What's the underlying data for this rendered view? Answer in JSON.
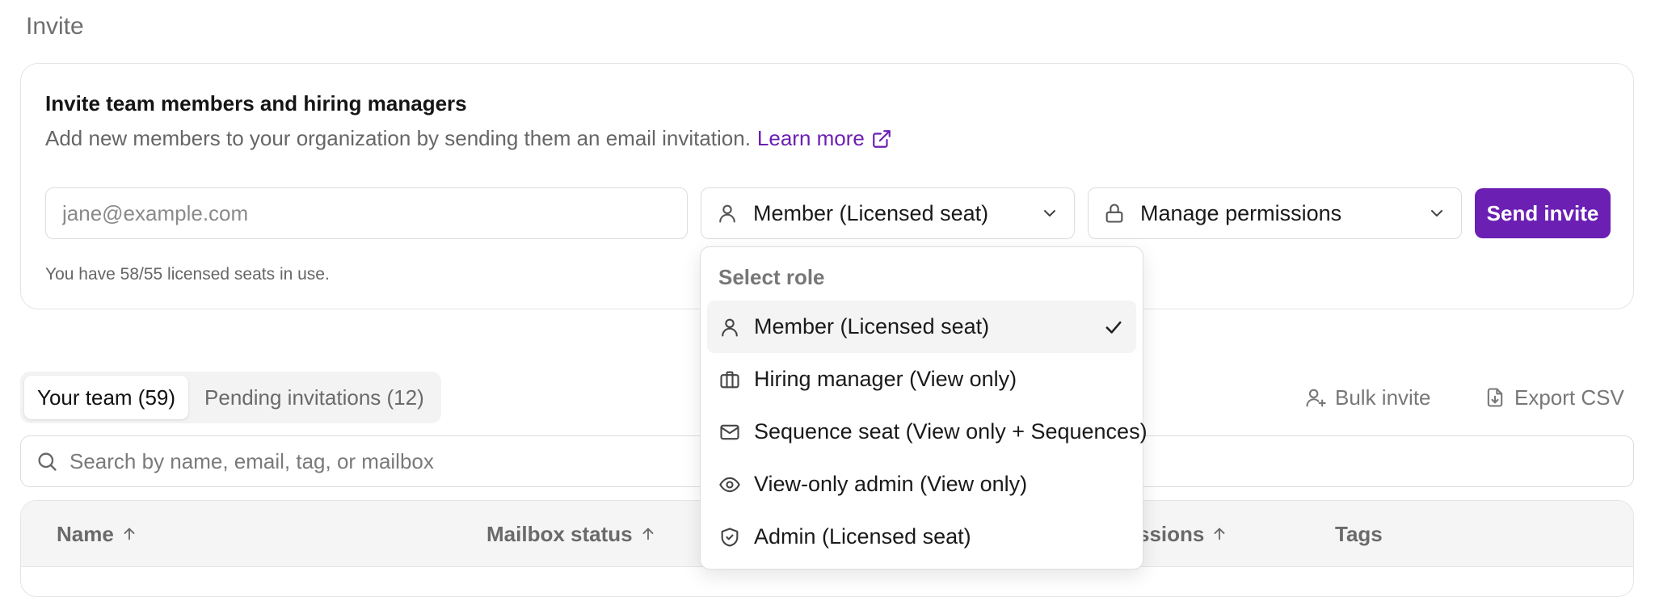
{
  "page": {
    "title": "Invite"
  },
  "invite_card": {
    "heading": "Invite team members and hiring managers",
    "description": "Add new members to your organization by sending them an email invitation.",
    "learn_more": "Learn more",
    "email_placeholder": "jane@example.com",
    "email_value": "",
    "role_select": {
      "selected": "Member (Licensed seat)",
      "icon": "user-icon"
    },
    "permissions_select": {
      "selected": "Manage permissions",
      "icon": "lock-icon"
    },
    "send_button": "Send invite",
    "seats_note": "You have 58/55 licensed seats in use."
  },
  "tabs": [
    {
      "label": "Your team (59)",
      "active": true
    },
    {
      "label": "Pending invitations (12)",
      "active": false
    }
  ],
  "actions": {
    "bulk_invite": "Bulk invite",
    "export_csv": "Export CSV"
  },
  "search": {
    "placeholder": "Search by name, email, tag, or mailbox",
    "value": ""
  },
  "table": {
    "columns": [
      {
        "label": "Name",
        "sortable": true
      },
      {
        "label": "Mailbox status",
        "sortable": true
      },
      {
        "label": "ssions",
        "sortable": true
      },
      {
        "label": "Tags",
        "sortable": false
      }
    ]
  },
  "role_dropdown": {
    "title": "Select role",
    "items": [
      {
        "label": "Member (Licensed seat)",
        "icon": "user-icon",
        "selected": true
      },
      {
        "label": "Hiring manager (View only)",
        "icon": "briefcase-icon",
        "selected": false
      },
      {
        "label": "Sequence seat (View only + Sequences)",
        "icon": "mail-icon",
        "selected": false
      },
      {
        "label": "View-only admin (View only)",
        "icon": "eye-icon",
        "selected": false
      },
      {
        "label": "Admin (Licensed seat)",
        "icon": "shield-icon",
        "selected": false
      }
    ]
  },
  "colors": {
    "accent": "#6b1fb3",
    "border": "#e4e4e4",
    "muted_text": "#6a6a6a"
  }
}
